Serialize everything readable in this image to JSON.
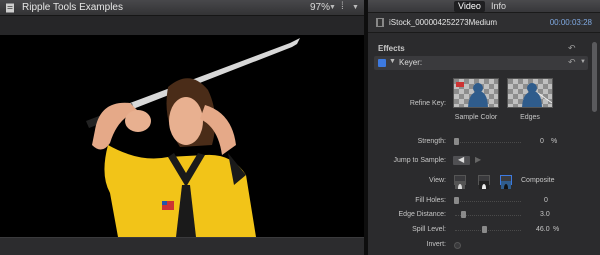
{
  "viewer": {
    "title": "Ripple Tools Examples",
    "zoom": "97%"
  },
  "inspector": {
    "tabs": [
      {
        "label": "Video"
      },
      {
        "label": "Info"
      }
    ],
    "clip_name": "iStock_000004252273Medium",
    "timecode": "00:00:03:28",
    "effects_label": "Effects",
    "effect_name": "Keyer:",
    "params": {
      "refine_key": "Refine Key:",
      "sample_color": "Sample Color",
      "edges": "Edges",
      "strength": "Strength:",
      "strength_value": "0",
      "strength_unit": "%",
      "jump_to_sample": "Jump to Sample:",
      "view": "View:",
      "view_value": "Composite",
      "fill_holes": "Fill Holes:",
      "fill_holes_value": "0",
      "edge_distance": "Edge Distance:",
      "edge_distance_value": "3.0",
      "spill_level": "Spill Level:",
      "spill_level_value": "46.0",
      "spill_level_unit": "%",
      "invert": "Invert:"
    }
  },
  "colors": {
    "accent": "#3d7ae0",
    "timecode": "#7fa8e0",
    "uniform": "#f2c418"
  },
  "icons": [
    "document-icon",
    "chevron-down-icon",
    "film-clip-icon",
    "reset-icon",
    "triangle-disclosure-icon",
    "checkbox-icon"
  ]
}
